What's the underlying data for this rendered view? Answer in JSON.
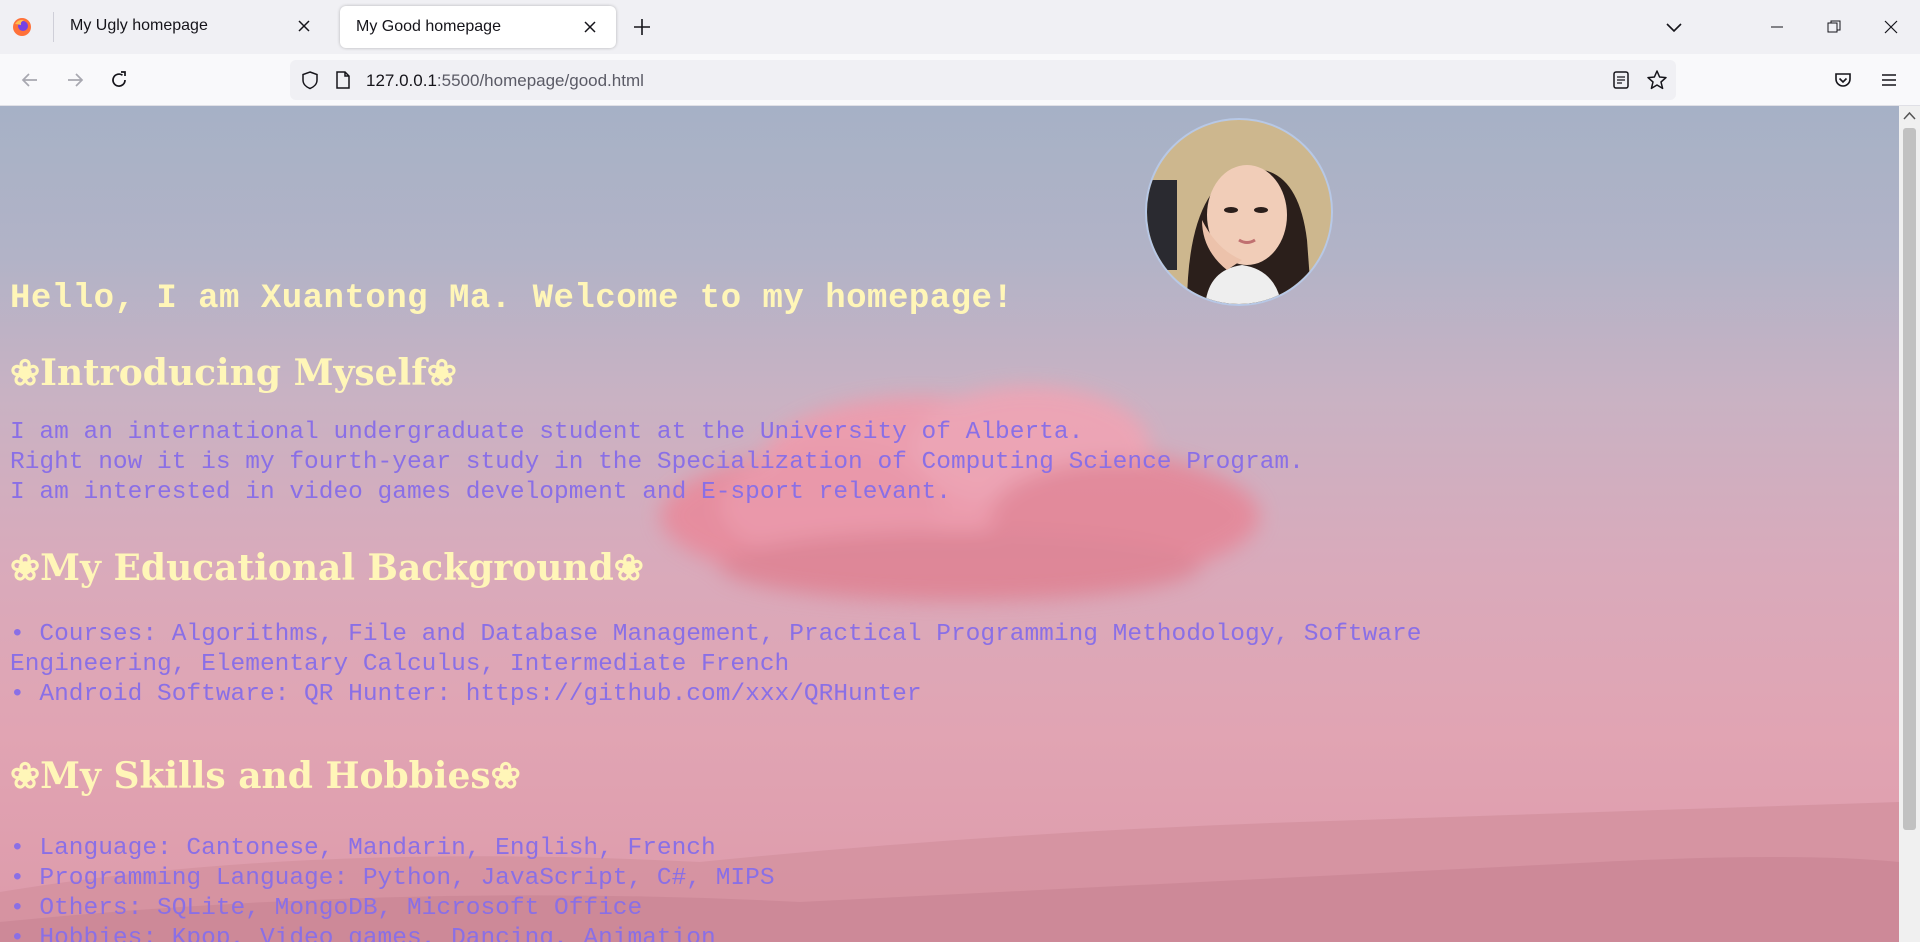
{
  "browser": {
    "tabs": [
      {
        "title": "My Ugly homepage",
        "active": false
      },
      {
        "title": "My Good homepage",
        "active": true
      }
    ],
    "url": {
      "host": "127.0.0.1",
      "rest": ":5500/homepage/good.html"
    }
  },
  "page": {
    "greeting": "Hello, I am Xuantong Ma. Welcome to my homepage!",
    "sections": [
      {
        "title": "❀Introducing Myself❀",
        "lines": [
          "I am an international undergraduate student at the University of Alberta.",
          "Right now it is my fourth-year study in the Specialization of Computing Science Program.",
          "I am interested in video games development and E-sport relevant."
        ]
      },
      {
        "title": "❀My Educational Background❀",
        "lines": [
          "• Courses: Algorithms, File and Database Management, Practical Programming Methodology, Software",
          "Engineering, Elementary Calculus, Intermediate French",
          "• Android Software: QR Hunter: https://github.com/xxx/QRHunter"
        ]
      },
      {
        "title": "❀My Skills and Hobbies❀",
        "lines": [
          "• Language: Cantonese, Mandarin, English, French",
          "• Programming Language: Python, JavaScript, C#, MIPS",
          "• Others: SQLite, MongoDB, Microsoft Office",
          "• Hobbies: Kpop, Video games, Dancing, Animation"
        ]
      }
    ]
  },
  "icons": {
    "browser_logo": "firefox-icon",
    "back": "arrow-left-icon",
    "forward": "arrow-right-icon",
    "reload": "reload-icon",
    "shield": "shield-icon",
    "page": "page-icon",
    "reader": "reader-view-icon",
    "bookmark": "star-icon",
    "pocket": "pocket-icon",
    "menu": "hamburger-menu-icon"
  },
  "colors": {
    "heading": "#fff6b8",
    "body_text": "#8a6fe6"
  }
}
